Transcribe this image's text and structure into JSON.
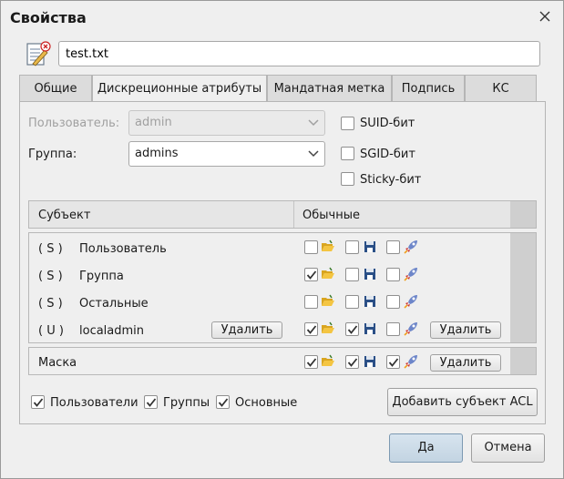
{
  "window": {
    "title": "Свойства"
  },
  "file": {
    "name": "test.txt"
  },
  "tabs": [
    {
      "label": "Общие"
    },
    {
      "label": "Дискреционные атрибуты"
    },
    {
      "label": "Мандатная метка"
    },
    {
      "label": "Подпись"
    },
    {
      "label": "КС"
    }
  ],
  "owner": {
    "user_label": "Пользователь:",
    "user_value": "admin",
    "group_label": "Группа:",
    "group_value": "admins"
  },
  "special_bits": [
    {
      "label": "SUID-бит",
      "checked": false
    },
    {
      "label": "SGID-бит",
      "checked": false
    },
    {
      "label": "Sticky-бит",
      "checked": false
    }
  ],
  "acl_table": {
    "header": {
      "subject": "Субъект",
      "normal": "Обычные"
    },
    "rows": [
      {
        "type": "( S )",
        "name": "Пользователь",
        "read": false,
        "write": false,
        "exec": false,
        "delete_label": ""
      },
      {
        "type": "( S )",
        "name": "Группа",
        "read": true,
        "write": false,
        "exec": false,
        "delete_label": ""
      },
      {
        "type": "( S )",
        "name": "Остальные",
        "read": false,
        "write": false,
        "exec": false,
        "delete_label": ""
      },
      {
        "type": "( U )",
        "name": "localadmin",
        "read": true,
        "write": true,
        "exec": false,
        "delete_label": "Удалить",
        "delete2_label": "Удалить"
      }
    ],
    "mask": {
      "name": "Маска",
      "read": true,
      "write": true,
      "exec": true,
      "delete_label": "Удалить"
    }
  },
  "filters": [
    {
      "label": "Пользователи",
      "checked": true
    },
    {
      "label": "Группы",
      "checked": true
    },
    {
      "label": "Основные",
      "checked": true
    }
  ],
  "add_acl_label": "Добавить субъект ACL",
  "footer": {
    "ok_label": "Да",
    "cancel_label": "Отмена"
  },
  "icons": {
    "read": "folder-open-icon",
    "write": "floppy-disk-icon",
    "exec": "rocket-icon"
  }
}
